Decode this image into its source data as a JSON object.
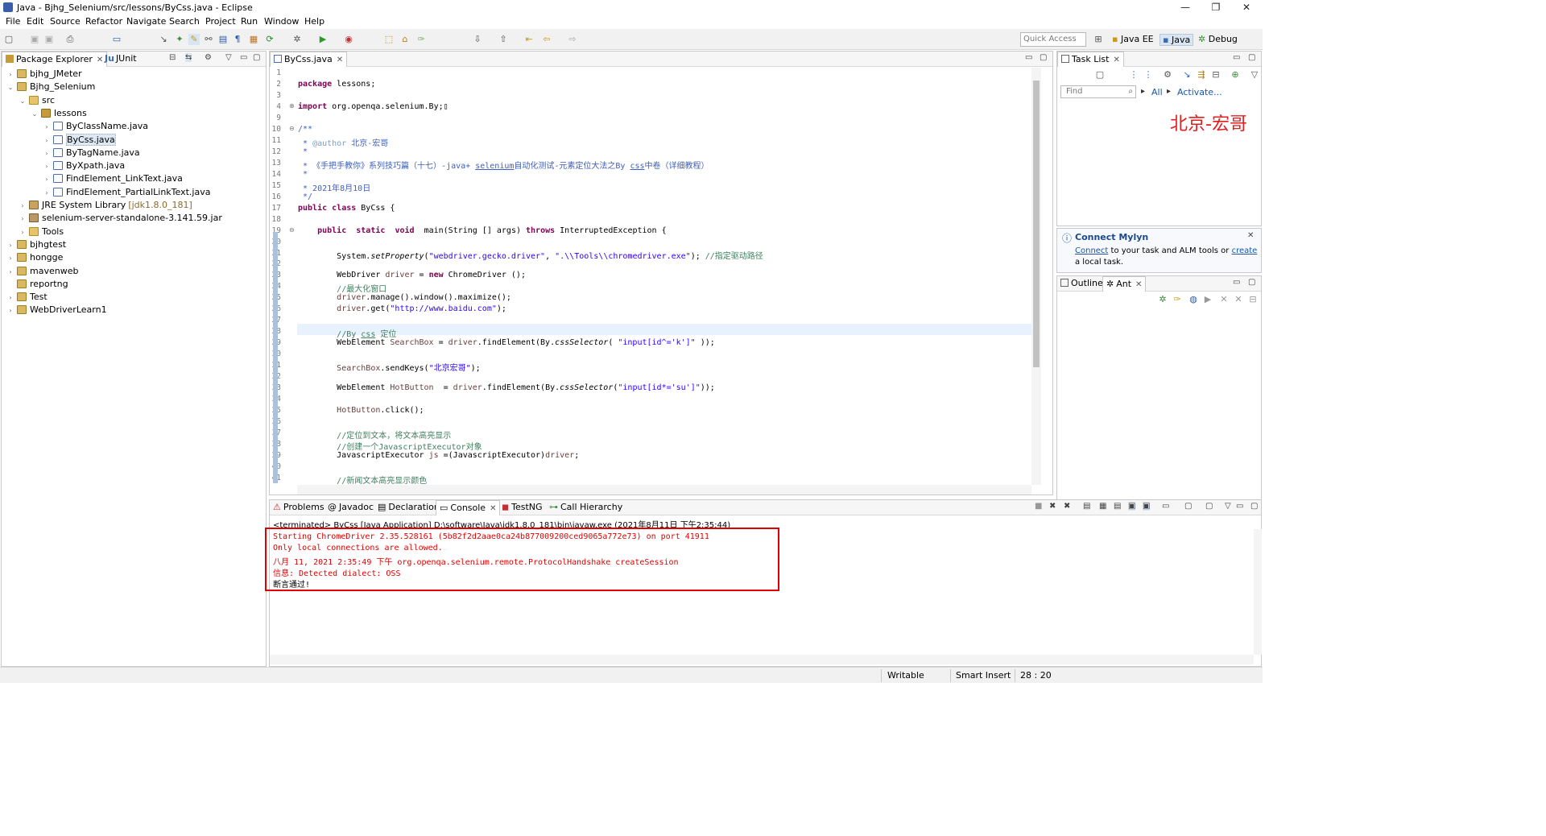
{
  "window": {
    "title": "Java - Bjhg_Selenium/src/lessons/ByCss.java - Eclipse",
    "min": "—",
    "max": "❐",
    "close": "✕"
  },
  "menu": [
    "File",
    "Edit",
    "Source",
    "Refactor",
    "Navigate",
    "Search",
    "Project",
    "Run",
    "Window",
    "Help"
  ],
  "toolbar": {
    "quick_access_placeholder": "Quick Access",
    "perspectives": [
      "Java EE",
      "Java",
      "Debug"
    ]
  },
  "package_explorer": {
    "tabs": [
      "Package Explorer",
      "JUnit"
    ],
    "tree": [
      {
        "label": "bjhg_JMeter",
        "depth": 0,
        "twisty": "›",
        "icon": "proj"
      },
      {
        "label": "Bjhg_Selenium",
        "depth": 0,
        "twisty": "⌄",
        "icon": "proj"
      },
      {
        "label": "src",
        "depth": 1,
        "twisty": "⌄",
        "icon": "folder"
      },
      {
        "label": "lessons",
        "depth": 2,
        "twisty": "⌄",
        "icon": "pkgic"
      },
      {
        "label": "ByClassName.java",
        "depth": 3,
        "twisty": "›",
        "icon": "java"
      },
      {
        "label": "ByCss.java",
        "depth": 3,
        "twisty": "›",
        "icon": "java",
        "selected": true
      },
      {
        "label": "ByTagName.java",
        "depth": 3,
        "twisty": "›",
        "icon": "java"
      },
      {
        "label": "ByXpath.java",
        "depth": 3,
        "twisty": "›",
        "icon": "java"
      },
      {
        "label": "FindElement_LinkText.java",
        "depth": 3,
        "twisty": "›",
        "icon": "java"
      },
      {
        "label": "FindElement_PartialLinkText.java",
        "depth": 3,
        "twisty": "›",
        "icon": "java"
      },
      {
        "label": "JRE System Library",
        "suffix": "[jdk1.8.0_181]",
        "depth": 1,
        "twisty": "›",
        "icon": "lib"
      },
      {
        "label": "selenium-server-standalone-3.141.59.jar",
        "depth": 1,
        "twisty": "›",
        "icon": "jar"
      },
      {
        "label": "Tools",
        "depth": 1,
        "twisty": "›",
        "icon": "folder"
      },
      {
        "label": "bjhgtest",
        "depth": 0,
        "twisty": "›",
        "icon": "proj"
      },
      {
        "label": "honggе",
        "depth": 0,
        "twisty": "›",
        "icon": "proj"
      },
      {
        "label": "mavenweb",
        "depth": 0,
        "twisty": "›",
        "icon": "proj"
      },
      {
        "label": "reportng",
        "depth": 0,
        "twisty": "",
        "icon": "proj"
      },
      {
        "label": "Test",
        "depth": 0,
        "twisty": "›",
        "icon": "proj"
      },
      {
        "label": "WebDriverLearn1",
        "depth": 0,
        "twisty": "›",
        "icon": "proj"
      }
    ]
  },
  "editor": {
    "tab": "ByCss.java",
    "lines": [
      {
        "n": "1",
        "html": ""
      },
      {
        "n": "2",
        "html": "<span class=\"kw\">package</span> lessons;"
      },
      {
        "n": "3",
        "html": ""
      },
      {
        "n": "4",
        "fold": "⊕",
        "html": "<span class=\"kw\">import</span> org.openqa.selenium.By;▯"
      },
      {
        "n": "9",
        "html": ""
      },
      {
        "n": "10",
        "fold": "⊖",
        "html": "<span class=\"doc\">/**</span>"
      },
      {
        "n": "11",
        "html": "<span class=\"doc\"> * <b style=\"color:#7f9fbf;font-weight:normal\">@author</b> 北京-宏哥</span>"
      },
      {
        "n": "12",
        "html": "<span class=\"doc\"> *</span>"
      },
      {
        "n": "13",
        "html": "<span class=\"doc\"> * 《手把手教你》系列技巧篇（十七）-java+ <u>selenium</u>自动化测试-元素定位大法之By <u>css</u>中卷（详细教程）</span>"
      },
      {
        "n": "14",
        "html": "<span class=\"doc\"> *</span>"
      },
      {
        "n": "15",
        "html": "<span class=\"doc\"> * 2021年8月10日</span>"
      },
      {
        "n": "16",
        "html": "<span class=\"doc\"> */</span>"
      },
      {
        "n": "17",
        "html": "<span class=\"kw\">public</span> <span class=\"kw\">class</span> ByCss {"
      },
      {
        "n": "18",
        "html": ""
      },
      {
        "n": "19",
        "fold": "⊖",
        "html": "    <span class=\"kw\">public</span>  <span class=\"kw\">static</span>  <span class=\"kw\">void</span>  main(String [] args) <span class=\"kw\">throws</span> InterruptedException {"
      },
      {
        "n": "20",
        "html": ""
      },
      {
        "n": "21",
        "html": "        System.<span class=\"ital\">setProperty</span>(<span class=\"str\">\"webdriver.gecko.driver\"</span>, <span class=\"str\">\".\\\\Tools\\\\chromedriver.exe\"</span>); <span class=\"cm\">//指定驱动路径</span>"
      },
      {
        "n": "22",
        "html": ""
      },
      {
        "n": "23",
        "html": "        WebDriver <span class=\"var\">driver</span> = <span class=\"kw\">new</span> ChromeDriver ();"
      },
      {
        "n": "24",
        "html": "        <span class=\"cm\">//最大化窗口</span>"
      },
      {
        "n": "25",
        "html": "        <span class=\"var\">driver</span>.manage().window().maximize();"
      },
      {
        "n": "26",
        "html": "        <span class=\"var\">driver</span>.get(<span class=\"str\">\"http://www.baidu.com\"</span>);"
      },
      {
        "n": "27",
        "html": ""
      },
      {
        "n": "28",
        "html": "        <span class=\"cm\">//By <u>css</u> 定位</span>"
      },
      {
        "n": "29",
        "html": "        WebElement <span class=\"var\">SearchBox</span> = <span class=\"var\">driver</span>.findElement(By.<span class=\"ital\">cssSelector</span>( <span class=\"str\">\"input[id^='k']\"</span> ));"
      },
      {
        "n": "30",
        "html": ""
      },
      {
        "n": "31",
        "html": "        <span class=\"var\">SearchBox</span>.sendKeys(<span class=\"str\">\"北京宏哥\"</span>);"
      },
      {
        "n": "32",
        "html": ""
      },
      {
        "n": "33",
        "html": "        WebElement <span class=\"var\">HotButton</span>  = <span class=\"var\">driver</span>.findElement(By.<span class=\"ital\">cssSelector</span>(<span class=\"str\">\"input[id*='su']\"</span>));"
      },
      {
        "n": "34",
        "html": ""
      },
      {
        "n": "35",
        "html": "        <span class=\"var\">HotButton</span>.click();"
      },
      {
        "n": "36",
        "html": ""
      },
      {
        "n": "37",
        "html": "        <span class=\"cm\">//定位到文本，将文本高亮显示</span>"
      },
      {
        "n": "38",
        "html": "        <span class=\"cm\">//创建一个JavascriptExecutor对象</span>"
      },
      {
        "n": "39",
        "html": "        JavascriptExecutor <span class=\"var\">js</span> =(JavascriptExecutor)<span class=\"var\">driver</span>;"
      },
      {
        "n": "40",
        "html": ""
      },
      {
        "n": "41",
        "html": "        <span class=\"cm\">//新闻文本高亮显示颜色</span>"
      }
    ]
  },
  "tasklist": {
    "tab": "Task List",
    "find_placeholder": "Find",
    "all": "All",
    "activate": "Activate...",
    "watermark": "北京-宏哥"
  },
  "mylyn": {
    "title": "Connect Mylyn",
    "link1": "Connect",
    "text1": " to your task and ALM tools or ",
    "link2": "create",
    "text2": "a local task."
  },
  "outline": {
    "tabs": [
      "Outline",
      "Ant"
    ]
  },
  "console": {
    "tabs": [
      "Problems",
      "Javadoc",
      "Declaration",
      "Console",
      "TestNG",
      "Call Hierarchy"
    ],
    "header": "<terminated> ByCss [Java Application] D:\\software\\Java\\jdk1.8.0_181\\bin\\javaw.exe (2021年8月11日 下午2:35:44)",
    "lines": [
      {
        "text": "Starting ChromeDriver 2.35.528161 (5b82f2d2aae0ca24b877009200ced9065a772e73) on port 41911",
        "err": true
      },
      {
        "text": "Only local connections are allowed.",
        "err": true
      },
      {
        "text": "八月 11, 2021 2:35:49 下午 org.openqa.selenium.remote.ProtocolHandshake createSession",
        "err": true
      },
      {
        "text": "信息: Detected dialect: OSS",
        "err": true
      },
      {
        "text": "断言通过!",
        "err": false
      }
    ]
  },
  "status": {
    "writable": "Writable",
    "insert": "Smart Insert",
    "position": "28 : 20"
  }
}
